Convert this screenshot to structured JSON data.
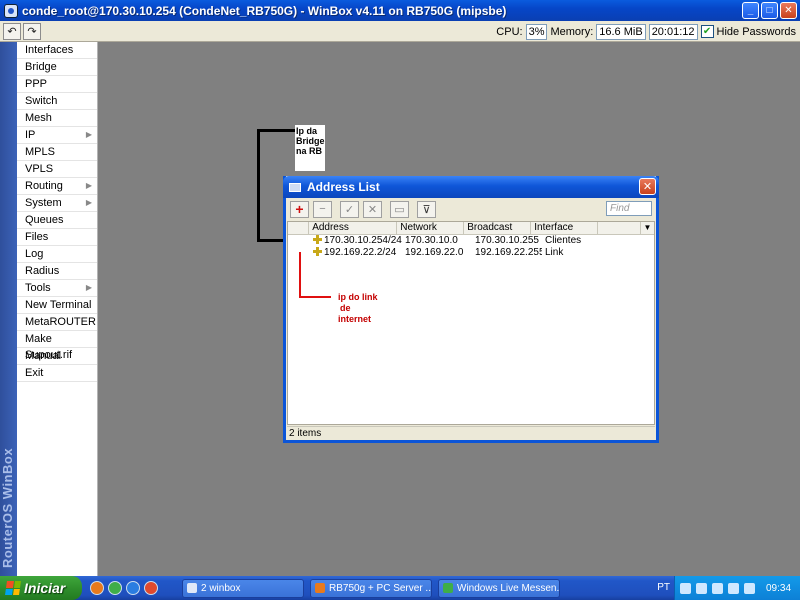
{
  "window": {
    "title": "conde_root@170.30.10.254 (CondeNet_RB750G) - WinBox v4.11 on RB750G (mipsbe)",
    "buttons": [
      "_",
      "□",
      "✕"
    ]
  },
  "toolbar": {
    "undo": "↶",
    "redo": "↷",
    "cpu_label": "CPU:",
    "cpu_value": "3%",
    "memory_label": "Memory:",
    "memory_value": "16.6 MiB",
    "time_value": "20:01:12",
    "hide_passwords_label": "Hide Passwords",
    "hide_passwords_checked": "✔"
  },
  "sidebar": {
    "brand": "RouterOS WinBox",
    "items": [
      {
        "label": "Interfaces",
        "arrow": ""
      },
      {
        "label": "Bridge",
        "arrow": ""
      },
      {
        "label": "PPP",
        "arrow": ""
      },
      {
        "label": "Switch",
        "arrow": ""
      },
      {
        "label": "Mesh",
        "arrow": ""
      },
      {
        "label": "IP",
        "arrow": "▶"
      },
      {
        "label": "MPLS",
        "arrow": ""
      },
      {
        "label": "VPLS",
        "arrow": ""
      },
      {
        "label": "Routing",
        "arrow": "▶"
      },
      {
        "label": "System",
        "arrow": "▶"
      },
      {
        "label": "Queues",
        "arrow": ""
      },
      {
        "label": "Files",
        "arrow": ""
      },
      {
        "label": "Log",
        "arrow": ""
      },
      {
        "label": "Radius",
        "arrow": ""
      },
      {
        "label": "Tools",
        "arrow": "▶"
      },
      {
        "label": "New Terminal",
        "arrow": ""
      },
      {
        "label": "MetaROUTER",
        "arrow": ""
      },
      {
        "label": "Make Supout.rif",
        "arrow": ""
      },
      {
        "label": "Manual",
        "arrow": ""
      },
      {
        "label": "Exit",
        "arrow": ""
      }
    ]
  },
  "annotations": {
    "bridge_note": [
      "Ip da",
      "Bridge",
      "na RB"
    ],
    "link_note": [
      "ip do link",
      "de",
      "internet"
    ]
  },
  "address_list": {
    "title": "Address List",
    "close": "✕",
    "tools": {
      "add": "+",
      "remove": "−",
      "enable": "✓",
      "disable": "✕",
      "comment": "▭",
      "filter": "⊽"
    },
    "find_placeholder": "Find",
    "columns": [
      "Address",
      "Network",
      "Broadcast",
      "Interface"
    ],
    "sort_arrow": "▼",
    "rows": [
      {
        "address": "170.30.10.254/24",
        "network": "170.30.10.0",
        "broadcast": "170.30.10.255",
        "interface": "Clientes"
      },
      {
        "address": "192.169.22.2/24",
        "network": "192.169.22.0",
        "broadcast": "192.169.22.255",
        "interface": "Link"
      }
    ],
    "status": "2 items"
  },
  "taskbar": {
    "start_label": "Iniciar",
    "tasks": [
      "2 winbox",
      "RB750g + PC Server ...",
      "Windows Live Messen..."
    ],
    "language": "PT",
    "clock": "09:34"
  }
}
